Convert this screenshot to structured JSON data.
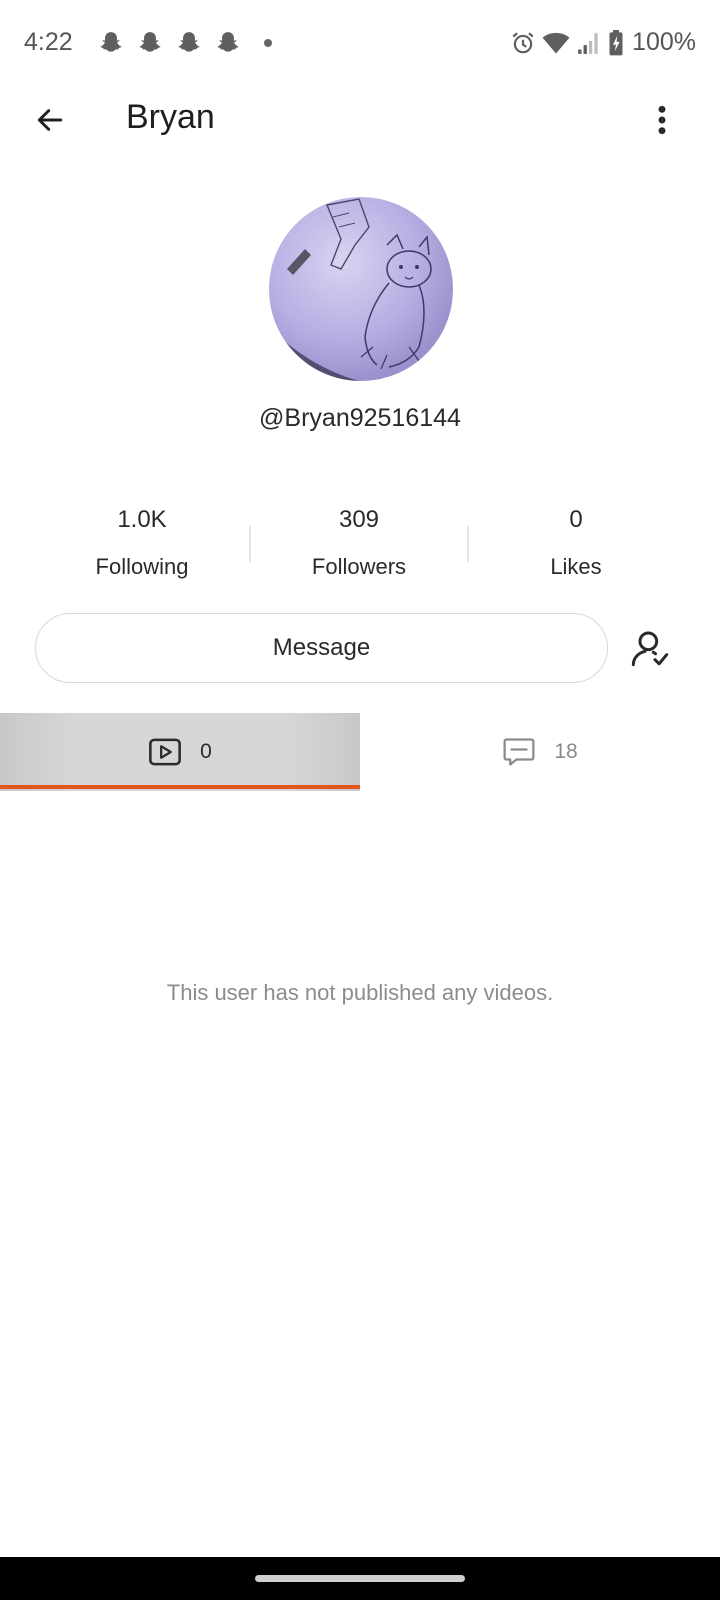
{
  "status_bar": {
    "time": "4:22",
    "battery": "100%",
    "notification_icons": [
      "snapchat-icon",
      "snapchat-icon",
      "snapchat-icon",
      "snapchat-icon"
    ],
    "system_icons": [
      "alarm-icon",
      "wifi-icon",
      "signal-icon",
      "battery-charging-icon"
    ]
  },
  "app_bar": {
    "title": "Bryan",
    "back_icon": "arrow-left-icon",
    "menu_icon": "more-vertical-icon"
  },
  "profile": {
    "handle": "@Bryan92516144",
    "avatar_icon": "dog-sketch-avatar"
  },
  "stats": {
    "following": {
      "value": "1.0K",
      "label": "Following"
    },
    "followers": {
      "value": "309",
      "label": "Followers"
    },
    "likes": {
      "value": "0",
      "label": "Likes"
    }
  },
  "actions": {
    "message_label": "Message",
    "follow_status_icon": "user-check-icon"
  },
  "tabs": [
    {
      "icon": "video-icon",
      "count": "0",
      "selected": true
    },
    {
      "icon": "comment-icon",
      "count": "18",
      "selected": false
    }
  ],
  "empty_state": "This user has not published any videos.",
  "colors": {
    "accent": "#e0561c",
    "selected_tab_bg": "#d6d6d6",
    "muted_text": "#8c8c8c"
  }
}
